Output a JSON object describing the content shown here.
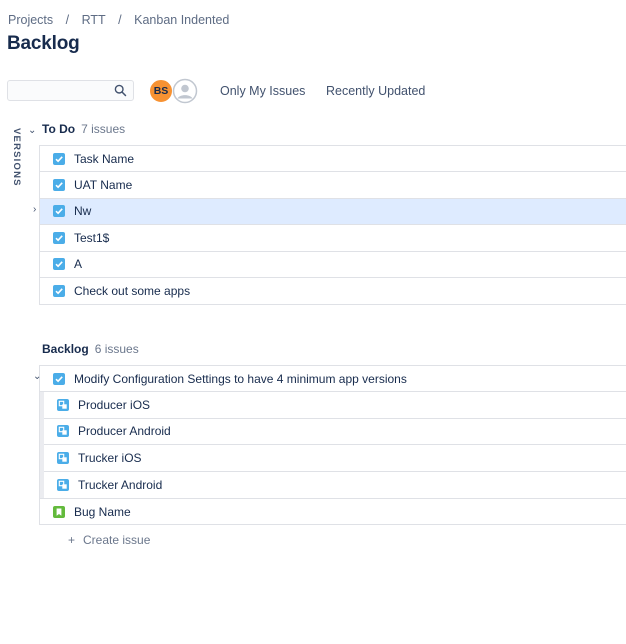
{
  "breadcrumb": [
    "Projects",
    "RTT",
    "Kanban Indented"
  ],
  "breadcrumb_separator": "/",
  "page_title": "Backlog",
  "search": {
    "value": "",
    "placeholder": ""
  },
  "avatars": [
    {
      "initials": "BS",
      "color": "#f79232"
    },
    {
      "initials": "",
      "icon": "user-placeholder-icon"
    }
  ],
  "filters": {
    "only_my_issues": "Only My Issues",
    "recently_updated": "Recently Updated"
  },
  "sidebar_label": "VERSIONS",
  "todo": {
    "name": "To Do",
    "count": "7 issues",
    "items": [
      {
        "summary": "Task Name",
        "type": "task-icon"
      },
      {
        "summary": "UAT Name",
        "type": "task-icon"
      },
      {
        "summary": "Nw",
        "type": "task-icon",
        "selected": true
      },
      {
        "summary": "Test1$",
        "type": "task-icon"
      },
      {
        "summary": "A",
        "type": "task-icon"
      },
      {
        "summary": "Check out some apps",
        "type": "task-icon"
      }
    ]
  },
  "backlog": {
    "name": "Backlog",
    "count": "6 issues",
    "parent": {
      "summary": "Modify Configuration Settings to have 4 minimum app versions",
      "type": "task-icon"
    },
    "subtasks": [
      {
        "summary": "Producer iOS",
        "type": "subtask-icon"
      },
      {
        "summary": "Producer Android",
        "type": "subtask-icon"
      },
      {
        "summary": "Trucker iOS",
        "type": "subtask-icon"
      },
      {
        "summary": "Trucker Android",
        "type": "subtask-icon"
      }
    ],
    "other": {
      "summary": "Bug Name",
      "type": "story-icon"
    }
  },
  "create_issue": {
    "plus": "+",
    "label": "Create issue"
  },
  "colors": {
    "task": "#4bade8",
    "story": "#63ba3c",
    "selected_row": "#deebff",
    "avatar_bs": "#f79232"
  }
}
